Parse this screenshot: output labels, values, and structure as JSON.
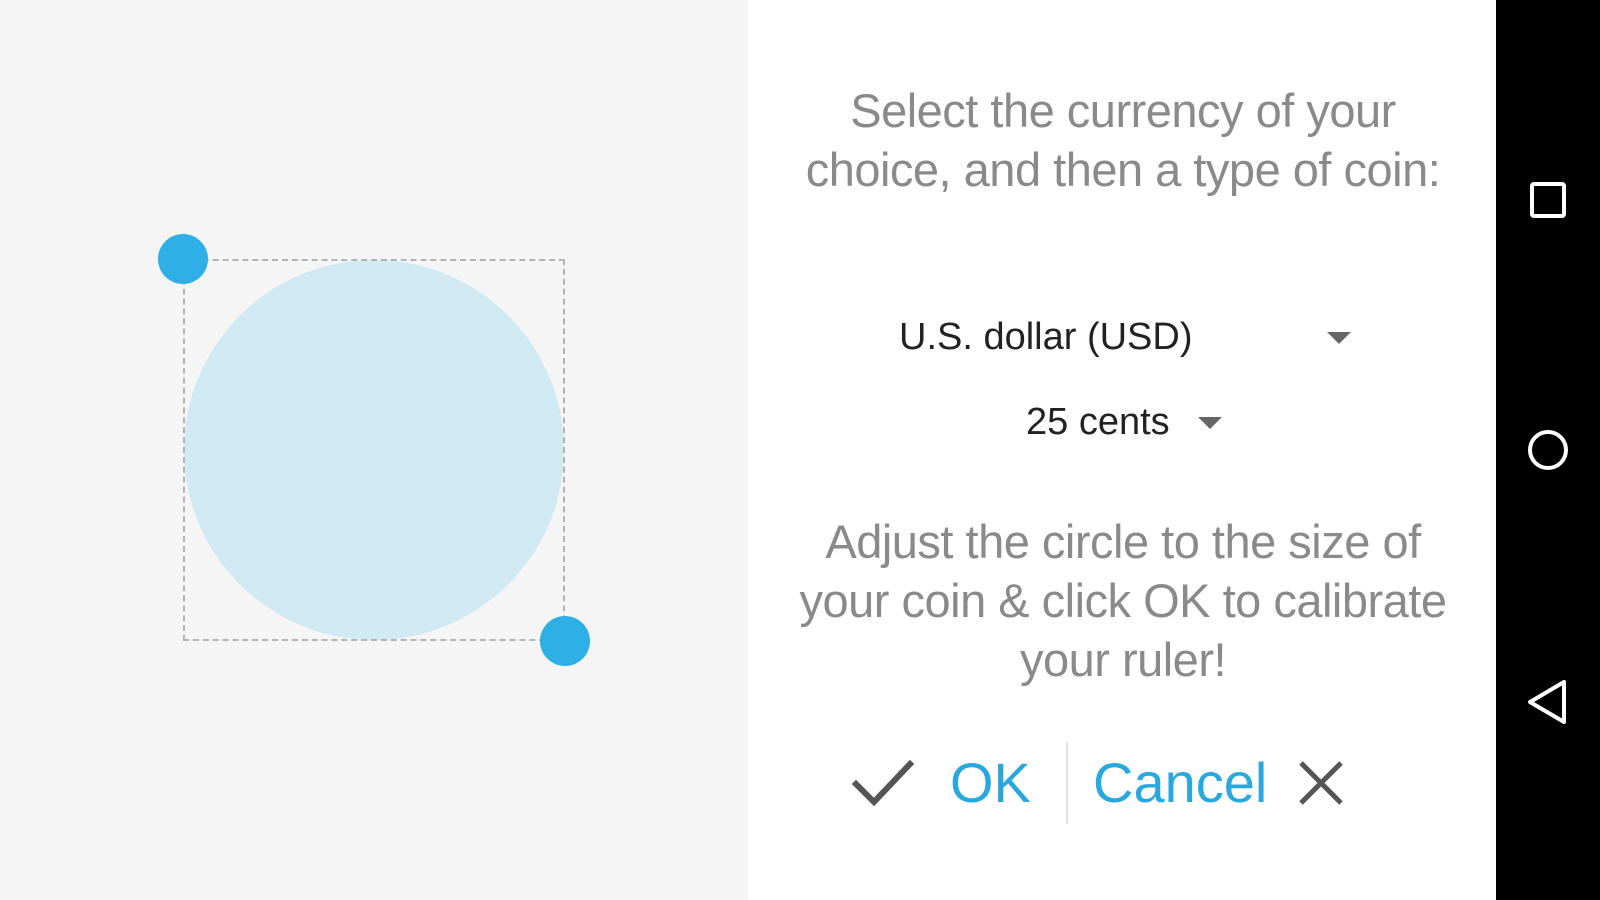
{
  "canvas": {
    "coin_color": "#d1e9f2",
    "handle_color": "#2eb0e6"
  },
  "panel": {
    "instruction_top": "Select the currency of your choice, and then a type of coin:",
    "currency": {
      "selected": "U.S. dollar (USD)"
    },
    "coin": {
      "selected": "25 cents"
    },
    "instruction_bottom": "Adjust the circle to the size of your coin & click OK to calibrate your ruler!",
    "ok_label": "OK",
    "cancel_label": "Cancel",
    "accent_color": "#29a8e0"
  },
  "navbar": {
    "icons": [
      "recent-apps-icon",
      "home-icon",
      "back-icon"
    ]
  }
}
